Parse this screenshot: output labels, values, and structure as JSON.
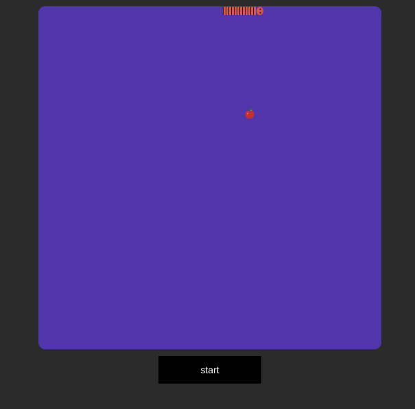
{
  "game": {
    "title": "",
    "board_color": "#5135ab",
    "background_color": "#2b2b2b",
    "snake": {
      "color": "#d9574d",
      "stripe_color": "#1d1226",
      "segment_count": 12,
      "direction": "right",
      "head_icon": "snake-head-icon"
    },
    "food": {
      "type": "apple",
      "icon": "apple-icon",
      "color": "#c62f2f"
    }
  },
  "controls": {
    "start_label": "start"
  }
}
